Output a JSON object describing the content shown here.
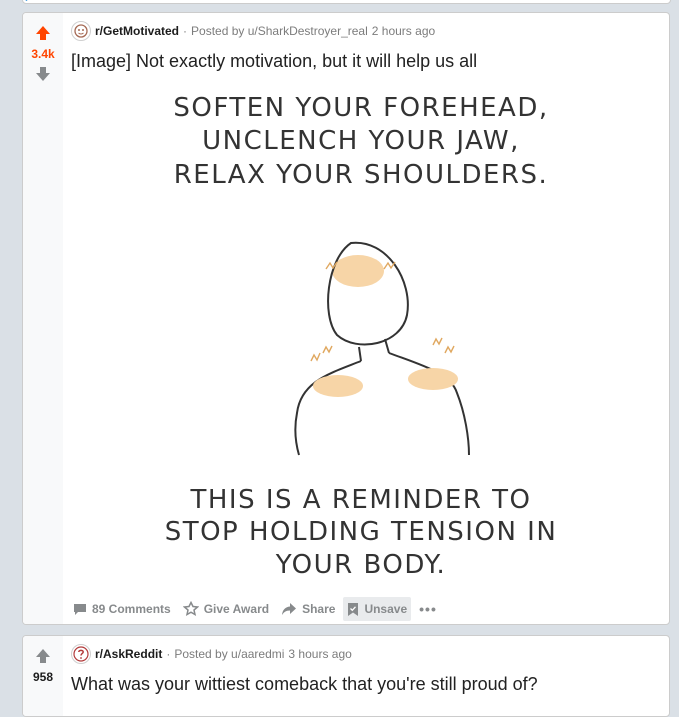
{
  "posts": [
    {
      "subreddit": "r/GetMotivated",
      "posted_by": "Posted by u/SharkDestroyer_real",
      "time": "2 hours ago",
      "score": "3.4k",
      "score_color": "#ff4500",
      "title": "[Image] Not exactly motivation, but it will help us all",
      "image_text_top": [
        "SOFTEN YOUR FOREHEAD,",
        "UNCLENCH YOUR JAW,",
        "RELAX YOUR SHOULDERS."
      ],
      "image_text_bottom": [
        "THIS IS A REMINDER TO",
        "STOP HOLDING TENSION IN",
        "YOUR BODY."
      ],
      "actions": {
        "comments": "89 Comments",
        "award": "Give Award",
        "share": "Share",
        "unsave": "Unsave",
        "more": "•••"
      }
    },
    {
      "subreddit": "r/AskReddit",
      "posted_by": "Posted by u/aaredmi",
      "time": "3 hours ago",
      "score": "958",
      "title": "What was your wittiest comeback that you're still proud of?"
    }
  ]
}
